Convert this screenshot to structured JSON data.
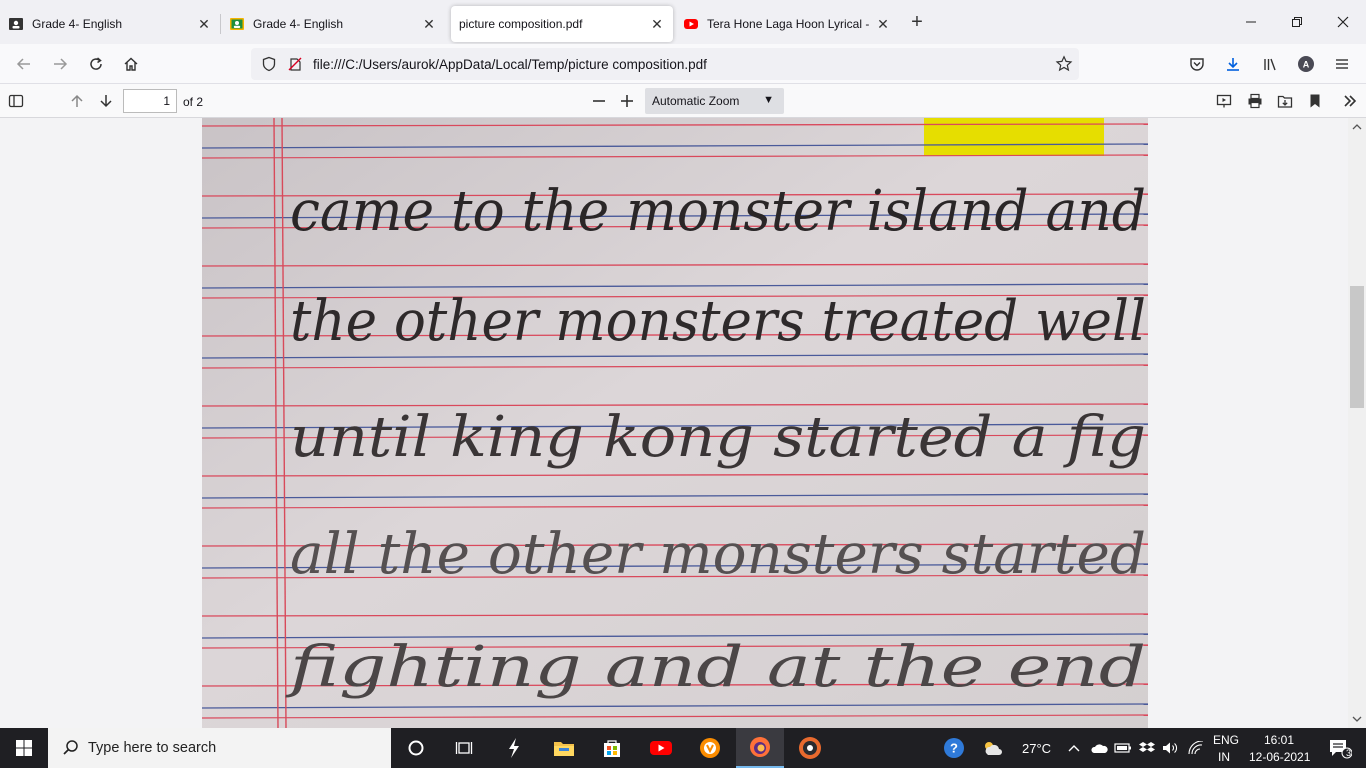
{
  "browser": {
    "tabs": [
      {
        "label": "Grade 4- English",
        "icon": "classroom-icon",
        "active": false
      },
      {
        "label": "Grade 4- English",
        "icon": "classroom-icon",
        "active": false
      },
      {
        "label": "picture composition.pdf",
        "icon": "",
        "active": true
      },
      {
        "label": "Tera Hone Laga Hoon Lyrical - A",
        "icon": "youtube-icon",
        "active": false
      }
    ],
    "url": "file:///C:/Users/aurok/AppData/Local/Temp/picture composition.pdf"
  },
  "pdf_toolbar": {
    "page_number": "1",
    "page_count": "of 2",
    "zoom": "Automatic Zoom"
  },
  "document": {
    "handwritten_lines": [
      "came to the monster island and",
      "the other monsters treated well",
      "until king kong started a fig",
      "all the other monsters started",
      "fighting and at the end"
    ]
  },
  "taskbar": {
    "search_placeholder": "Type here to search",
    "weather": "27°C",
    "lang_top": "ENG",
    "lang_bottom": "IN",
    "time": "16:01",
    "date": "12-06-2021",
    "notifications": "3"
  },
  "colors": {
    "accent": "#0060df",
    "highlight": "#e6de00",
    "youtube": "#ff0000"
  }
}
